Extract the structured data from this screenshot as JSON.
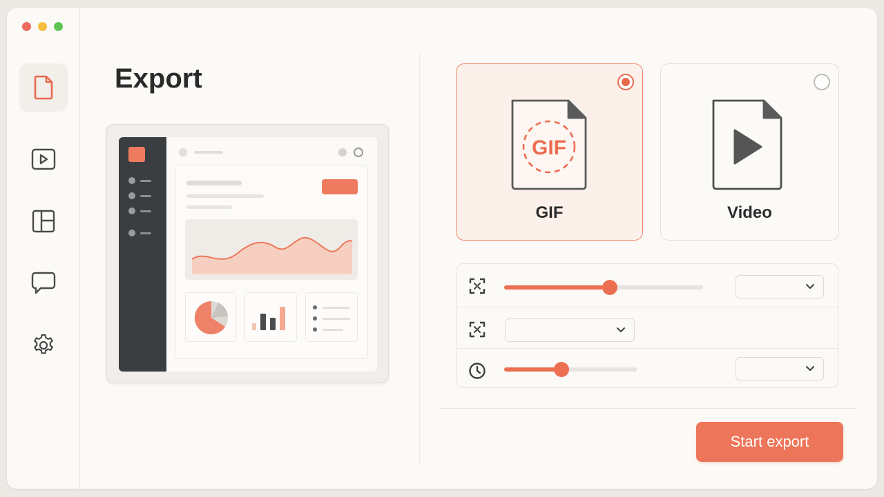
{
  "window": {
    "controls": [
      "close",
      "minimize",
      "zoom"
    ]
  },
  "sidebar": {
    "items": [
      {
        "name": "file",
        "icon": "file-icon",
        "active": true
      },
      {
        "name": "video",
        "icon": "play-square-icon",
        "active": false
      },
      {
        "name": "layout",
        "icon": "layout-grid-icon",
        "active": false
      },
      {
        "name": "comments",
        "icon": "chat-bubble-icon",
        "active": false
      },
      {
        "name": "settings",
        "icon": "gear-icon",
        "active": false
      }
    ]
  },
  "main": {
    "title": "Export"
  },
  "formats": {
    "gif": {
      "label": "GIF",
      "badge": "GIF",
      "selected": true,
      "icon": "gif-file-icon"
    },
    "video": {
      "label": "Video",
      "selected": false,
      "icon": "video-file-icon"
    }
  },
  "settings": {
    "rows": [
      {
        "icon": "fullscreen-icon",
        "slider_value": 0.53,
        "select_value": ""
      },
      {
        "icon": "fullscreen-icon",
        "select_value": ""
      },
      {
        "icon": "clock-icon",
        "slider_value": 0.43,
        "select_value": ""
      }
    ]
  },
  "actions": {
    "start_label": "Start export"
  },
  "colors": {
    "accent": "#ED7559",
    "accent_light": "#FCF0EA",
    "text": "#2A2A2A",
    "sidebar_dark": "#3B3E40"
  }
}
